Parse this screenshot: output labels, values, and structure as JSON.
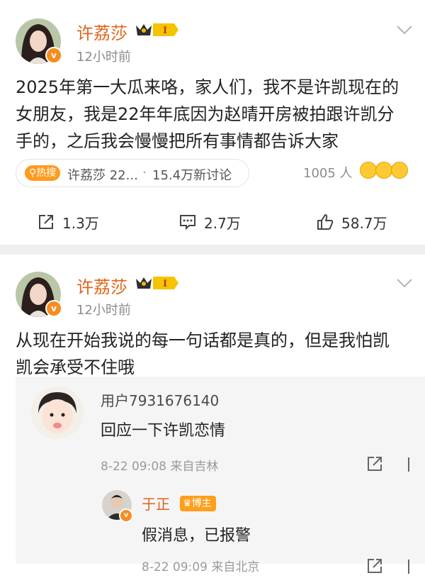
{
  "post1": {
    "username": "许荔莎",
    "level_badge": "I",
    "time": "12小时前",
    "text_line1": "2025年第一大瓜来咯，家人们，我不是许凯现在的",
    "text_line2": "女朋友，我是22年年底因为赵晴开房被拍跟许凯分",
    "text_line3": "手的，之后我会慢慢把所有事情都告诉大家",
    "topic": {
      "hot_label": "热搜",
      "name": "许荔莎 22...",
      "separator": "·",
      "count": "15.4万新讨论"
    },
    "viewers": "1005 人",
    "actions": {
      "repost": "1.3万",
      "comments": "2.7万",
      "likes": "58.7万"
    }
  },
  "post2": {
    "username": "许荔莎",
    "level_badge": "I",
    "time": "12小时前",
    "text_line1": "从现在开始我说的每一句话都是真的，但是我怕凯",
    "text_line2": "凯会承受不住哦",
    "comments": [
      {
        "user": "用户7931676140",
        "text": "回应一下许凯恋情",
        "meta": "8-22 09:08  来自吉林",
        "reply": {
          "user": "于正",
          "badge": "博主",
          "text": "假消息，已报警",
          "meta": "8-22 09:09  来自北京"
        }
      }
    ]
  },
  "colors": {
    "username": "#e0651a",
    "badge_orange": "#f78c1f",
    "hot_orange": "#ff9b1e",
    "meta_gray": "#8c8c8c",
    "divider": "#efefef"
  }
}
